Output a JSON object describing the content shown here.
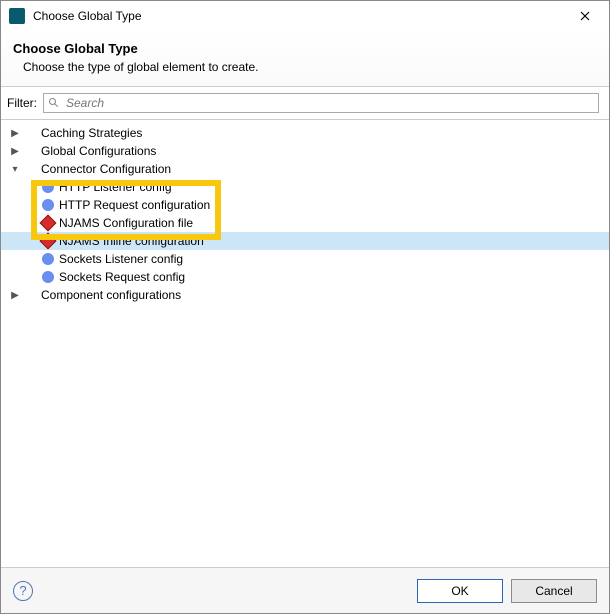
{
  "titlebar": {
    "title": "Choose Global Type"
  },
  "header": {
    "title": "Choose Global Type",
    "subtitle": "Choose the type of global element to create."
  },
  "filter": {
    "label": "Filter:",
    "placeholder": "Search"
  },
  "tree": {
    "n0": "Caching Strategies",
    "n1": "Global Configurations",
    "n2": "Connector Configuration",
    "n2_0": "HTTP Listener config",
    "n2_1": "HTTP Request configuration",
    "n2_2": "NJAMS Configuration file",
    "n2_3": "NJAMS Inline configuration",
    "n2_4": "Sockets Listener config",
    "n2_5": "Sockets Request config",
    "n3": "Component configurations"
  },
  "footer": {
    "ok": "OK",
    "cancel": "Cancel"
  }
}
